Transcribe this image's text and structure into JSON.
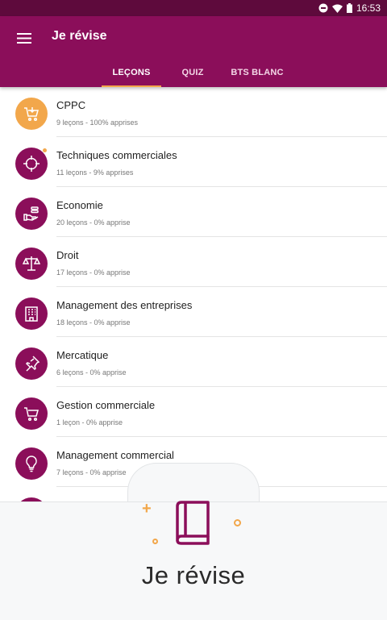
{
  "status_bar": {
    "time": "16:53",
    "icons": [
      "do-not-disturb-icon",
      "wifi-icon",
      "battery-icon"
    ]
  },
  "app_bar": {
    "title": "Je révise",
    "menu_icon": "hamburger-menu-icon"
  },
  "tabs": [
    {
      "label": "LEÇONS",
      "active": true
    },
    {
      "label": "QUIZ",
      "active": false
    },
    {
      "label": "BTS BLANC",
      "active": false
    }
  ],
  "subjects": [
    {
      "title": "CPPC",
      "subtitle": "9 leçons - 100% apprises",
      "icon": "cart-download-icon",
      "highlight": true
    },
    {
      "title": "Techniques commerciales",
      "subtitle": "11 leçons - 9% apprises",
      "icon": "target-icon",
      "badge": true
    },
    {
      "title": "Economie",
      "subtitle": "20 leçons - 0% apprise",
      "icon": "coins-hand-icon"
    },
    {
      "title": "Droit",
      "subtitle": "17 leçons - 0% apprise",
      "icon": "scales-icon"
    },
    {
      "title": "Management des entreprises",
      "subtitle": "18 leçons - 0% apprise",
      "icon": "building-icon"
    },
    {
      "title": "Mercatique",
      "subtitle": "6 leçons - 0% apprise",
      "icon": "pushpin-icon"
    },
    {
      "title": "Gestion commerciale",
      "subtitle": "1 leçon - 0% apprise",
      "icon": "shopping-cart-icon"
    },
    {
      "title": "Management commercial",
      "subtitle": "7 leçons - 0% apprise",
      "icon": "lightbulb-icon"
    }
  ],
  "branding": {
    "text": "Je révise",
    "icon": "book-icon"
  },
  "colors": {
    "primary": "#8b0e5a",
    "status_bar": "#5e0a3c",
    "accent": "#f2a74b"
  }
}
